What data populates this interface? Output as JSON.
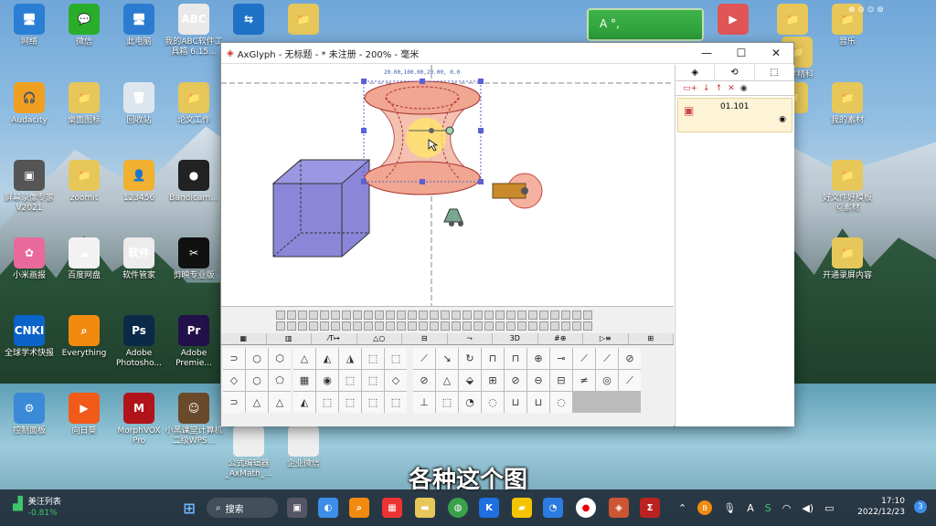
{
  "desktop_left": [
    {
      "label": "网络",
      "color": "#2a7fd4",
      "glyph": "🖥"
    },
    {
      "label": "微信",
      "color": "#2aae2a",
      "glyph": "💬"
    },
    {
      "label": "此电脑",
      "color": "#2b7cd0",
      "glyph": "🖥"
    },
    {
      "label": "我的ABC软件工具箱 6.15...",
      "color": "#e9e9e9",
      "glyph": "ABC"
    },
    {
      "label": "",
      "color": "#1f72c6",
      "glyph": "⇆"
    },
    {
      "label": "",
      "color": "#e7c75a",
      "glyph": "📁"
    },
    {
      "label": "Audacity",
      "color": "#f0a020",
      "glyph": "🎧"
    },
    {
      "label": "桌面图标",
      "color": "#e7c75a",
      "glyph": "📁"
    },
    {
      "label": "回收站",
      "color": "#dde6ee",
      "glyph": "🗑"
    },
    {
      "label": "论文工作",
      "color": "#e7c75a",
      "glyph": "📁"
    },
    {
      "label": "屏幕录像专家V2021",
      "color": "#555",
      "glyph": "▣"
    },
    {
      "label": "zoomit",
      "color": "#e7c75a",
      "glyph": "📁"
    },
    {
      "label": "123456",
      "color": "#f0b030",
      "glyph": "👤"
    },
    {
      "label": "Bandicam...",
      "color": "#222",
      "glyph": "●"
    },
    {
      "label": "小米画报",
      "color": "#e96a9a",
      "glyph": "✿"
    },
    {
      "label": "百度网盘",
      "color": "#f2f2f2",
      "glyph": "☁"
    },
    {
      "label": "软件管家",
      "color": "#ececec",
      "glyph": "软件"
    },
    {
      "label": "剪映专业版",
      "color": "#111",
      "glyph": "✂"
    },
    {
      "label": "全球学术快报",
      "color": "#0a63c9",
      "glyph": "CNKI"
    },
    {
      "label": "Everything",
      "color": "#f28a10",
      "glyph": "⌕"
    },
    {
      "label": "Adobe Photosho...",
      "color": "#0b2a48",
      "glyph": "Ps"
    },
    {
      "label": "Adobe Premie...",
      "color": "#22104a",
      "glyph": "Pr"
    },
    {
      "label": "控制面板",
      "color": "#3b8ad8",
      "glyph": "⚙"
    },
    {
      "label": "向日葵",
      "color": "#f25a1a",
      "glyph": "▶"
    },
    {
      "label": "MorphVOX Pro",
      "color": "#b0141a",
      "glyph": "M"
    },
    {
      "label": "小黑课堂计算机二级WPS...",
      "color": "#6a4a2a",
      "glyph": "☺"
    },
    {
      "label": "公式编辑器_AxMath_...",
      "color": "#eee",
      "glyph": ""
    },
    {
      "label": "企业微信",
      "color": "#eee",
      "glyph": ""
    }
  ],
  "desktop_right": [
    {
      "label": "",
      "color": "#e05555",
      "glyph": "▶"
    },
    {
      "label": "",
      "color": "#e7c75a",
      "glyph": "📁"
    },
    {
      "label": "音乐",
      "color": "#e7c75a",
      "glyph": "📁"
    },
    {
      "label": "",
      "color": "#e7c75a",
      "glyph": "📁"
    },
    {
      "label": "数学精科",
      "color": "#e7c75a",
      "glyph": "📁"
    },
    {
      "label": "我的素材",
      "color": "#e7c75a",
      "glyph": "📁"
    },
    {
      "label": "好文件好模板 Ⓒ素材",
      "color": "#e7c75a",
      "glyph": "📁"
    },
    {
      "label": "开通录屏内容",
      "color": "#e7c75a",
      "glyph": "📁"
    }
  ],
  "greenbox": {
    "text": "A °,"
  },
  "window": {
    "title": "AxGlyph - 无标题 - * 未注册 - 200% - 毫米",
    "minimize": "—",
    "maximize": "☐",
    "close": "✕",
    "ruler_text": "20.00,100.00,20.00, 0.0",
    "side_tabs": [
      "◈",
      "⟲",
      "⬚"
    ],
    "layer_name": "01.101",
    "tab_labels": [
      "▦",
      "▥",
      "⁄T↦",
      "△○",
      "⊟",
      "⤳",
      "3D",
      "#⊕",
      "▷≡",
      "⊞"
    ],
    "palette_a": [
      "⊃",
      "○",
      "⬡",
      "◇",
      "○",
      "⬠",
      "⊃",
      "△",
      "△"
    ],
    "palette_b": [
      "△",
      "◭",
      "◮",
      "⬚",
      "⬚",
      "▦",
      "◉",
      "⬚",
      "⬚",
      "◇",
      "◭",
      "⬚",
      "⬚",
      "⬚",
      "⬚"
    ],
    "palette_c": [
      "⟋",
      "↘",
      "↻",
      "⊓",
      "⊓",
      "⊕",
      "⊸",
      "⟋",
      "⟋",
      "⊘",
      "⊘",
      "△",
      "⬙",
      "⊞",
      "⊘",
      "⊖",
      "⊟",
      "≠",
      "◎",
      "⟋",
      "⊥",
      "⬚",
      "◔",
      "◌",
      "⊔",
      "⊔",
      "◌"
    ]
  },
  "subtitle": "各种这个图",
  "taskbar": {
    "stock_name": "美汪列表",
    "stock_change": "-0.81%",
    "search": "搜索",
    "time": "17:10",
    "date": "2022/12/23",
    "notif": "3",
    "input_lang": "A",
    "s_badge": "S"
  },
  "colors": {
    "cube": "#8b86d8",
    "hyperboloid": "#f3b7a4",
    "accent": "#d07a2a"
  }
}
